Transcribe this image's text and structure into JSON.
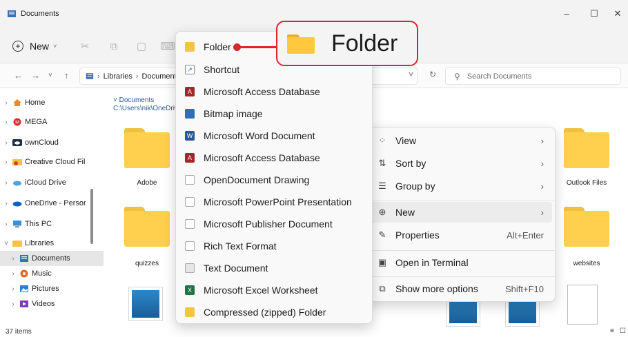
{
  "window": {
    "title": "Documents"
  },
  "toolbar": {
    "new_label": "New"
  },
  "address": {
    "parts": [
      "Libraries",
      "Document"
    ],
    "search_placeholder": "Search Documents"
  },
  "sidebar": {
    "items": [
      {
        "label": "Home"
      },
      {
        "label": "MEGA"
      },
      {
        "label": "ownCloud"
      },
      {
        "label": "Creative Cloud Fil"
      },
      {
        "label": "iCloud Drive"
      },
      {
        "label": "OneDrive - Persor"
      },
      {
        "label": "This PC"
      },
      {
        "label": "Libraries"
      },
      {
        "label": "Documents"
      },
      {
        "label": "Music"
      },
      {
        "label": "Pictures"
      },
      {
        "label": "Videos"
      }
    ]
  },
  "content": {
    "group_title": "Documents",
    "group_path": "C:\\Users\\nik\\OneDriv",
    "labels": {
      "adobe": "Adobe",
      "quizzes": "quizzes",
      "outlook_files": "Outlook Files",
      "websites": "websites"
    }
  },
  "status": {
    "count": "37 items"
  },
  "context_menu": {
    "view": "View",
    "sort_by": "Sort by",
    "group_by": "Group by",
    "new": "New",
    "properties": "Properties",
    "properties_shortcut": "Alt+Enter",
    "open_terminal": "Open in Terminal",
    "show_more": "Show more options",
    "show_more_shortcut": "Shift+F10"
  },
  "new_submenu": {
    "items": [
      {
        "label": "Folder"
      },
      {
        "label": "Shortcut"
      },
      {
        "label": "Microsoft Access Database"
      },
      {
        "label": "Bitmap image"
      },
      {
        "label": "Microsoft Word Document"
      },
      {
        "label": "Microsoft Access Database"
      },
      {
        "label": "OpenDocument Drawing"
      },
      {
        "label": "Microsoft PowerPoint Presentation"
      },
      {
        "label": "Microsoft Publisher Document"
      },
      {
        "label": "Rich Text Format"
      },
      {
        "label": "Text Document"
      },
      {
        "label": "Microsoft Excel Worksheet"
      },
      {
        "label": "Compressed (zipped) Folder"
      }
    ]
  },
  "callout": {
    "label": "Folder"
  },
  "colors": {
    "accent_red": "#d9252c",
    "folder_yellow": "#ffcf4d"
  }
}
